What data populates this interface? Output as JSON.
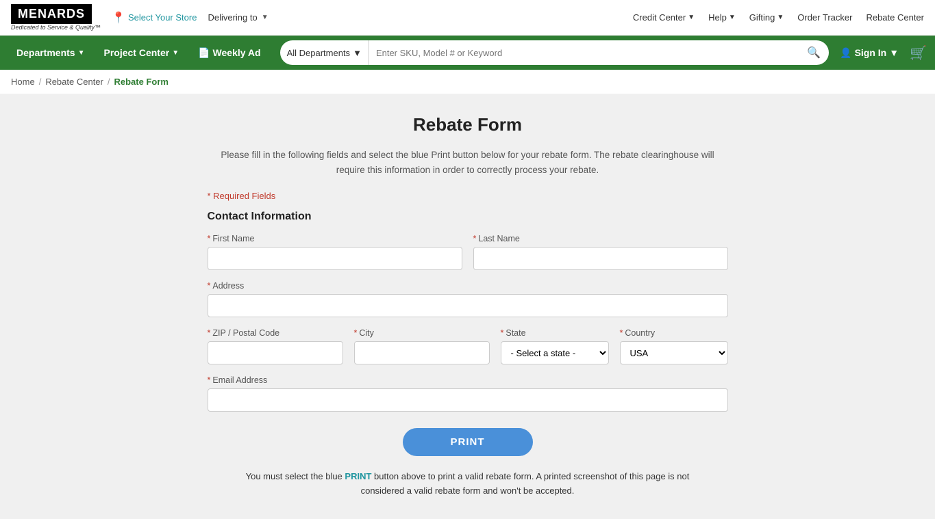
{
  "topbar": {
    "logo": "MENARDS",
    "tagline": "Dedicated to Service & Quality™",
    "store_selector": "Select Your Store",
    "delivering_to": "Delivering to",
    "links": [
      {
        "id": "credit-center",
        "label": "Credit Center",
        "has_chevron": true
      },
      {
        "id": "help",
        "label": "Help",
        "has_chevron": true
      },
      {
        "id": "gifting",
        "label": "Gifting",
        "has_chevron": true
      },
      {
        "id": "order-tracker",
        "label": "Order Tracker",
        "has_chevron": false
      },
      {
        "id": "rebate-center",
        "label": "Rebate Center",
        "has_chevron": false
      }
    ]
  },
  "navbar": {
    "departments_label": "Departments",
    "project_center_label": "Project Center",
    "weekly_ad_label": "Weekly Ad",
    "search_placeholder": "Enter SKU, Model # or Keyword",
    "all_departments_label": "All Departments",
    "sign_in_label": "Sign In"
  },
  "breadcrumb": {
    "home": "Home",
    "rebate_center": "Rebate Center",
    "current": "Rebate Form"
  },
  "form": {
    "title": "Rebate Form",
    "description": "Please fill in the following fields and select the blue Print button below for your rebate form. The rebate clearinghouse will require this information in order to correctly process your rebate.",
    "required_note": "* Required Fields",
    "section_title": "Contact Information",
    "fields": {
      "first_name_label": "First Name",
      "last_name_label": "Last Name",
      "address_label": "Address",
      "zip_label": "ZIP / Postal Code",
      "city_label": "City",
      "state_label": "State",
      "country_label": "Country",
      "email_label": "Email Address",
      "state_default": "- Select a state -",
      "country_default": "USA"
    },
    "print_button": "PRINT",
    "bottom_note_part1": "You must select the blue PRINT button above to print a valid rebate form. A printed screenshot of this page is not",
    "bottom_note_part2": "considered a valid rebate form and won't be accepted.",
    "bottom_note_highlight": "PRINT"
  }
}
